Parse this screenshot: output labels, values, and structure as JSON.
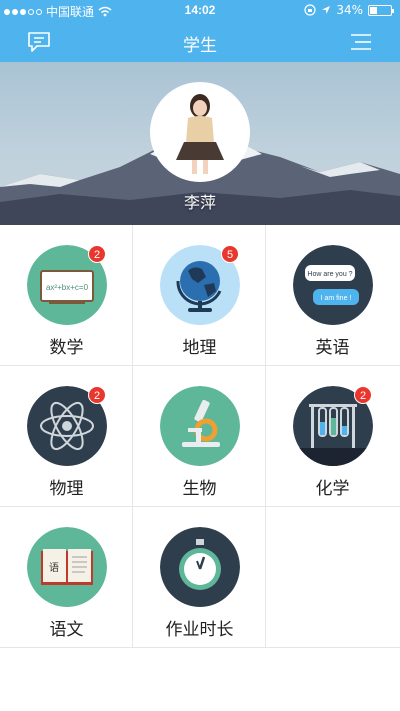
{
  "status_bar": {
    "carrier": "中国联通",
    "time": "14:02",
    "battery": "34%",
    "battery_level": 0.34
  },
  "nav": {
    "title": "学生",
    "left_icon": "message-icon",
    "right_icon": "menu-icon"
  },
  "profile": {
    "name": "李萍"
  },
  "subjects": [
    {
      "label": "数学",
      "icon": "blackboard-icon",
      "badge": "2",
      "color": "#5fb79a"
    },
    {
      "label": "地理",
      "icon": "globe-icon",
      "badge": "5",
      "color": "#b9e0f7"
    },
    {
      "label": "英语",
      "icon": "chat-bubbles-icon",
      "badge": "",
      "color": "#2f3e4d"
    },
    {
      "label": "物理",
      "icon": "atom-icon",
      "badge": "2",
      "color": "#2f3e4d"
    },
    {
      "label": "生物",
      "icon": "microscope-icon",
      "badge": "",
      "color": "#5fb79a"
    },
    {
      "label": "化学",
      "icon": "test-tubes-icon",
      "badge": "2",
      "color": "#2f3e4d"
    },
    {
      "label": "语文",
      "icon": "book-icon",
      "badge": "",
      "color": "#5fb79a"
    },
    {
      "label": "作业时长",
      "icon": "stopwatch-icon",
      "badge": "",
      "color": "#2f3e4d"
    }
  ],
  "icon_text": {
    "equation": "ax²+bx+c=0",
    "bubble_1": "How are you ?",
    "bubble_2": "I am fine !",
    "book_char": "语"
  },
  "colors": {
    "primary": "#4fb3ee",
    "badge": "#e9372e"
  }
}
